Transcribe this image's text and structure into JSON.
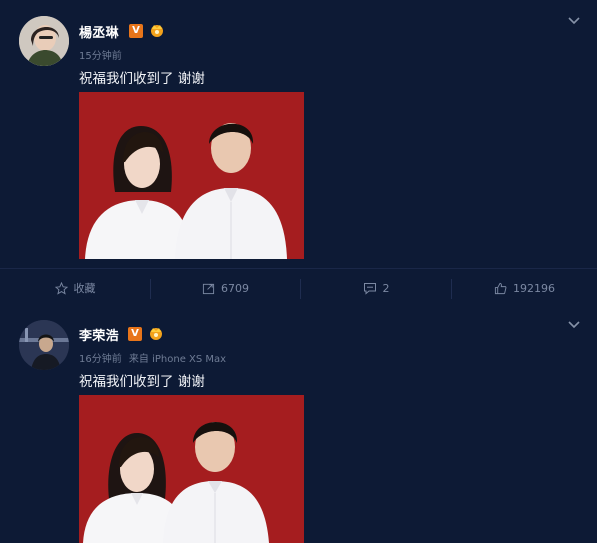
{
  "posts": [
    {
      "username": "楊丞琳",
      "verified_badge": "V",
      "time": "15分钟前",
      "source": "",
      "text": "祝福我们收到了 谢谢",
      "icons": [
        "v-badge-icon",
        "crown-badge-icon",
        "chevron-down-icon"
      ]
    },
    {
      "username": "李荣浩",
      "verified_badge": "V",
      "time": "16分钟前",
      "source": "来自 iPhone XS Max",
      "text": "祝福我们收到了 谢谢",
      "icons": [
        "v-badge-icon",
        "crown-badge-icon",
        "chevron-down-icon"
      ]
    }
  ],
  "actions": {
    "favorite_label": "收藏",
    "repost_count": "6709",
    "comment_count": "2",
    "like_count": "192196"
  },
  "colors": {
    "background": "#0d1a35",
    "badge": "#e8751a",
    "photo_bg": "#a51d1f",
    "muted_text": "#6f7c95"
  }
}
